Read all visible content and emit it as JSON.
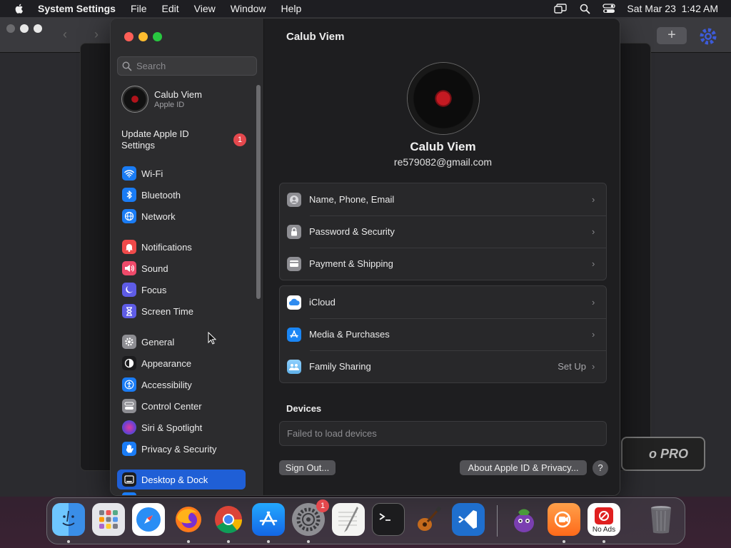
{
  "menubar": {
    "app_name": "System Settings",
    "menus": [
      "File",
      "Edit",
      "View",
      "Window",
      "Help"
    ],
    "datetime": "Sat Mar 23  1:42 AM"
  },
  "background_window": {
    "badge_text": "o PRO"
  },
  "sidebar": {
    "search_placeholder": "Search",
    "account": {
      "name": "Calub Viem",
      "subtitle": "Apple ID"
    },
    "update": {
      "label": "Update Apple ID Settings",
      "count": "1"
    },
    "items": [
      {
        "label": "Wi-Fi",
        "icon": "wifi-icon",
        "color": "#1a7cf5"
      },
      {
        "label": "Bluetooth",
        "icon": "bluetooth-icon",
        "color": "#1a7cf5"
      },
      {
        "label": "Network",
        "icon": "globe-icon",
        "color": "#1a7cf5"
      },
      {
        "label": "Notifications",
        "icon": "bell-icon",
        "color": "#ef4a4a"
      },
      {
        "label": "Sound",
        "icon": "speaker-icon",
        "color": "#ef4a6a"
      },
      {
        "label": "Focus",
        "icon": "moon-icon",
        "color": "#5e5ce6"
      },
      {
        "label": "Screen Time",
        "icon": "hourglass-icon",
        "color": "#5e5ce6"
      },
      {
        "label": "General",
        "icon": "gear-icon",
        "color": "#8e8e93"
      },
      {
        "label": "Appearance",
        "icon": "appearance-icon",
        "color": "#1c1c1e"
      },
      {
        "label": "Accessibility",
        "icon": "accessibility-icon",
        "color": "#1a7cf5"
      },
      {
        "label": "Control Center",
        "icon": "control-center-icon",
        "color": "#8e8e93"
      },
      {
        "label": "Siri & Spotlight",
        "icon": "siri-icon",
        "color": "#6a3fd0"
      },
      {
        "label": "Privacy & Security",
        "icon": "hand-icon",
        "color": "#1a7cf5"
      },
      {
        "label": "Desktop & Dock",
        "icon": "dock-icon",
        "color": "#1c1c1e"
      }
    ]
  },
  "main": {
    "title": "Calub Viem",
    "profile_name": "Calub Viem",
    "profile_email": "re579082@gmail.com",
    "group1": [
      {
        "label": "Name, Phone, Email",
        "icon": "contact-card-icon",
        "value": ""
      },
      {
        "label": "Password & Security",
        "icon": "lock-icon",
        "value": ""
      },
      {
        "label": "Payment & Shipping",
        "icon": "credit-card-icon",
        "value": ""
      }
    ],
    "group2": [
      {
        "label": "iCloud",
        "icon": "icloud-icon",
        "value": ""
      },
      {
        "label": "Media & Purchases",
        "icon": "app-store-icon",
        "value": ""
      },
      {
        "label": "Family Sharing",
        "icon": "family-icon",
        "value": "Set Up"
      }
    ],
    "devices_heading": "Devices",
    "devices_status": "Failed to load devices",
    "sign_out_label": "Sign Out...",
    "about_label": "About Apple ID & Privacy...",
    "help_label": "?"
  },
  "dock": {
    "apps": [
      {
        "name": "Finder",
        "icon": "finder-icon",
        "running": true
      },
      {
        "name": "Launchpad",
        "icon": "launchpad-icon",
        "running": false
      },
      {
        "name": "Safari",
        "icon": "safari-icon",
        "running": false
      },
      {
        "name": "Firefox",
        "icon": "firefox-icon",
        "running": true
      },
      {
        "name": "Chrome",
        "icon": "chrome-icon",
        "running": true
      },
      {
        "name": "App Store",
        "icon": "app-store-icon",
        "running": true
      },
      {
        "name": "System Settings",
        "icon": "system-settings-icon",
        "running": true,
        "badge": "1"
      },
      {
        "name": "TextEdit",
        "icon": "textedit-icon",
        "running": false
      },
      {
        "name": "Terminal",
        "icon": "terminal-icon",
        "running": false
      },
      {
        "name": "GarageBand",
        "icon": "guitar-icon",
        "running": false
      },
      {
        "name": "Visual Studio Code",
        "icon": "vscode-icon",
        "running": false
      },
      {
        "name": "Eggplant",
        "icon": "eggplant-icon",
        "running": false
      },
      {
        "name": "Screen Recorder",
        "icon": "recorder-icon",
        "running": true
      },
      {
        "name": "No Ads",
        "icon": "no-ads-icon",
        "running": true,
        "label": "No Ads"
      },
      {
        "name": "Trash",
        "icon": "trash-icon",
        "running": false
      }
    ]
  }
}
